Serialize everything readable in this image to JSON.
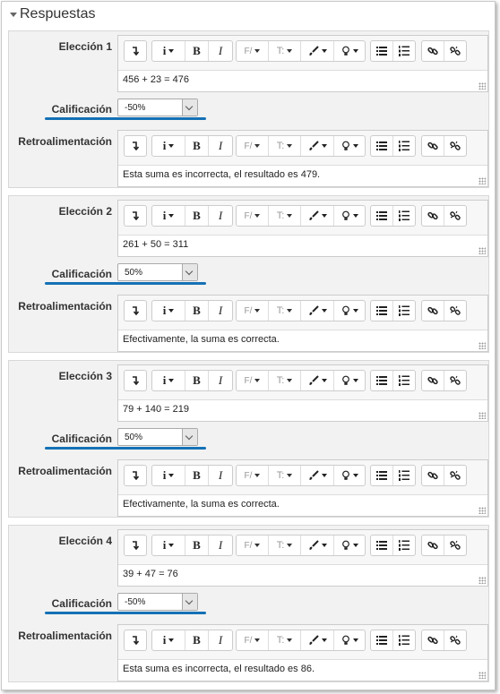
{
  "section": {
    "title": "Respuestas"
  },
  "labels": {
    "calificacion": "Calificación",
    "retroalimentacion": "Retroalimentación"
  },
  "toolbar": {
    "info_glyph": "i",
    "bold_glyph": "B",
    "italic_glyph": "I",
    "font_glyph": "F/",
    "size_glyph": "T:"
  },
  "choices": [
    {
      "label": "Elección 1",
      "answer": "456 + 23 = 476",
      "grade": "-50%",
      "feedback": "Esta suma es incorrecta, el resultado es 479."
    },
    {
      "label": "Elección 2",
      "answer": "261 + 50 = 311",
      "grade": "50%",
      "feedback": "Efectivamente, la suma es correcta."
    },
    {
      "label": "Elección 3",
      "answer": "79 + 140 = 219",
      "grade": "50%",
      "feedback": "Efectivamente, la suma es correcta."
    },
    {
      "label": "Elección 4",
      "answer": "39 + 47 = 76",
      "grade": "-50%",
      "feedback": "Esta suma es incorrecta, el resultado es 86."
    }
  ],
  "colors": {
    "underline": "#1571b5",
    "panel": "#f2f2f2"
  }
}
